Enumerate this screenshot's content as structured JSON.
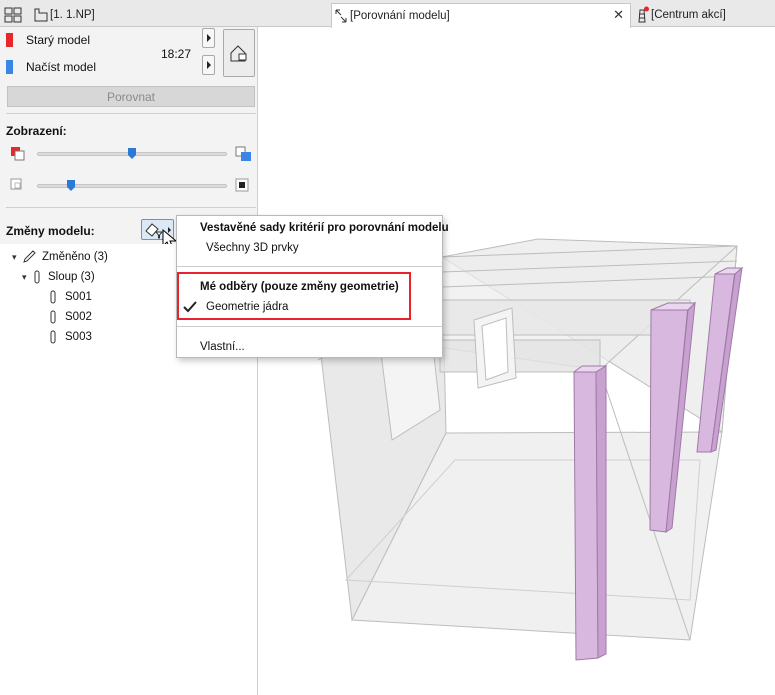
{
  "tabs": [
    {
      "label": "[1. 1.NP]"
    },
    {
      "label": "[Porovnání modelu]"
    },
    {
      "label": "[Centrum akcí]"
    }
  ],
  "panel": {
    "old_model_label": "Starý model",
    "load_model_label": "Načíst model",
    "time": "18:27",
    "compare_button": "Porovnat",
    "display_heading": "Zobrazení:",
    "changes_heading": "Změny modelu:",
    "old_model_color": "#e8262c",
    "new_model_color": "#3a86e8"
  },
  "tree": {
    "changed": "Změněno (3)",
    "column_group": "Sloup (3)",
    "items": [
      "S001",
      "S002",
      "S003"
    ]
  },
  "menu": {
    "builtin_header": "Vestavěné sady kritérií pro porovnání modelu",
    "all_3d": "Všechny 3D prvky",
    "my_subscriptions_header": "Mé odběry (pouze změny geometrie)",
    "core_geometry": "Geometrie jádra",
    "custom": "Vlastní..."
  },
  "colors": {
    "highlight_frame": "#e8232c",
    "column_fill": "#d9b8df",
    "slider_thumb": "#2a7bd6"
  }
}
